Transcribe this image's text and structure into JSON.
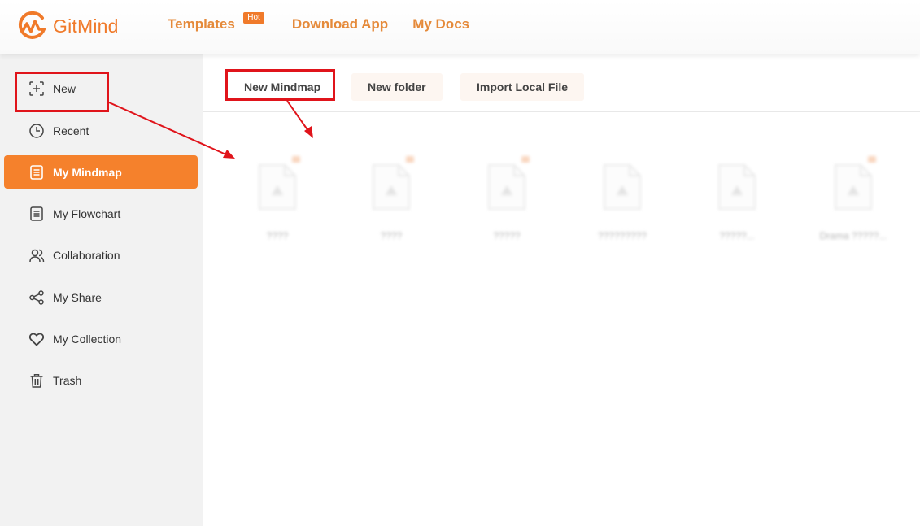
{
  "app": {
    "logo_text": "GitMind",
    "brand_color": "#f07a2a"
  },
  "nav": {
    "templates": "Templates",
    "hot_badge": "Hot",
    "download": "Download App",
    "docs": "My Docs"
  },
  "sidebar": {
    "items": [
      {
        "label": "New",
        "icon": "new-plus-icon"
      },
      {
        "label": "Recent",
        "icon": "clock-icon"
      },
      {
        "label": "My Mindmap",
        "icon": "document-icon",
        "active": true
      },
      {
        "label": "My Flowchart",
        "icon": "document-icon"
      },
      {
        "label": "Collaboration",
        "icon": "users-icon"
      },
      {
        "label": "My Share",
        "icon": "share-icon"
      },
      {
        "label": "My Collection",
        "icon": "heart-icon"
      },
      {
        "label": "Trash",
        "icon": "trash-icon"
      }
    ],
    "active_color": "#f5812c"
  },
  "toolbar": {
    "new_mindmap": "New Mindmap",
    "new_folder": "New folder",
    "import": "Import Local File"
  },
  "files": [
    {
      "name": "????"
    },
    {
      "name": "????"
    },
    {
      "name": "?????"
    },
    {
      "name": "?????????"
    },
    {
      "name": "?????..."
    },
    {
      "name": "Drama ?????..."
    }
  ],
  "annotation_color": "#e0141b"
}
